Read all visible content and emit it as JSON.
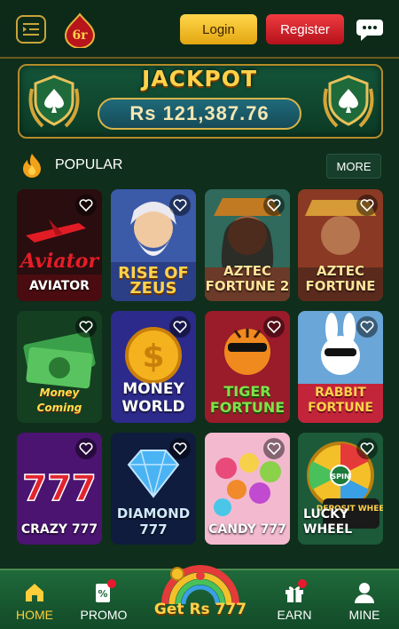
{
  "header": {
    "login_label": "Login",
    "register_label": "Register",
    "logo_text": "6r"
  },
  "jackpot": {
    "title": "JACKPOT",
    "value": "Rs 121,387.76"
  },
  "section": {
    "title": "POPULAR",
    "more_label": "MORE"
  },
  "games": [
    {
      "label": "AVIATOR",
      "logo_text": "Aviator"
    },
    {
      "label": "RISE OF ZEUS"
    },
    {
      "label": "AZTEC FORTUNE 2"
    },
    {
      "label": "AZTEC FORTUNE"
    },
    {
      "label": "Money Coming"
    },
    {
      "label": "MONEY WORLD"
    },
    {
      "label": "TIGER FORTUNE"
    },
    {
      "label": "RABBIT FORTUNE"
    },
    {
      "label": "CRAZY 777"
    },
    {
      "label": "DIAMOND 777"
    },
    {
      "label": "CANDY 777"
    },
    {
      "label": "LUCKY WHEEL",
      "badge": "DEPOSIT WHEEL",
      "wheel_text": "SPIN"
    }
  ],
  "nav": {
    "home": "HOME",
    "promo": "PROMO",
    "center": "Get Rs 777",
    "earn": "EARN",
    "mine": "MINE"
  },
  "colors": {
    "background": "#0f2e1c",
    "accent_gold": "#ffd24a",
    "login": "#f4c02a",
    "register": "#d4222a",
    "nav": "#1f6a3a"
  }
}
